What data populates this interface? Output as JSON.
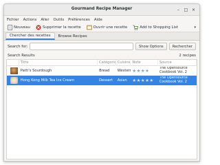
{
  "window": {
    "title": "Gourmand Recipe Manager"
  },
  "menu": [
    "Fichier",
    "Actions",
    "Aller",
    "Outils",
    "Préférences",
    "Aide"
  ],
  "toolbar": {
    "new_label": "Nouveau",
    "delete_label": "Supprimer la recette",
    "open_label": "Ouvrir une recette",
    "shopping_label": "Add to Shopping List"
  },
  "tabs": [
    "Chercher des recettes",
    "Browse Recipes"
  ],
  "search": {
    "label": "Search for:",
    "value": "",
    "show_options": "Show Options",
    "search_button": "Rechercher"
  },
  "results": {
    "heading": "Search Results",
    "count": "2 recipes",
    "columns": [
      "Titre",
      "Catégorie",
      "Cuisine",
      "Note",
      "Source"
    ],
    "rows": [
      {
        "title": "Patti's Sourdough",
        "category": "Bread",
        "cuisine": "Western",
        "rating": 4,
        "source": "The Opensource Cookbook Vol. 2"
      },
      {
        "title": "Hong Kong Milk Tea Ice Cream",
        "category": "Dessert",
        "cuisine": "Asian",
        "rating": 5,
        "source": "The Opensource Cookbook Vol. 2"
      }
    ]
  },
  "colors": {
    "accent": "#3584e4",
    "star": "#7f9ec2"
  },
  "icons": [
    "new-recipe-icon",
    "delete-icon",
    "open-recipe-icon",
    "shopping-cart-icon",
    "chevron-down-icon"
  ]
}
